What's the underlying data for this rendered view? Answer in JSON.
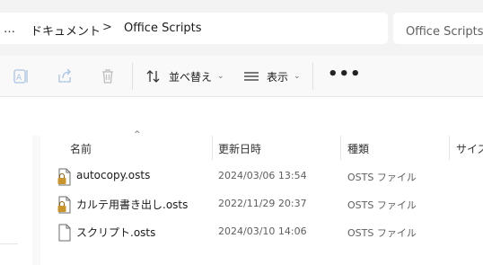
{
  "address_bar": {
    "more": "…",
    "breadcrumbs": [
      "ドキュメント",
      "Office Scripts"
    ],
    "separator": ">",
    "search_text": "Office Scriptsの"
  },
  "toolbar": {
    "sort_label": "並べ替え",
    "view_label": "表示",
    "more": "•••"
  },
  "columns": {
    "name": "名前",
    "modified": "更新日時",
    "type": "種類",
    "size": "サイズ"
  },
  "files": [
    {
      "name": "autocopy.osts",
      "modified": "2024/03/06 13:54",
      "type": "OSTS ファイル",
      "icon": "locked-file-icon"
    },
    {
      "name": "カルテ用書き出し.osts",
      "modified": "2022/11/29 20:37",
      "type": "OSTS ファイル",
      "icon": "locked-file-icon"
    },
    {
      "name": "スクリプト.osts",
      "modified": "2024/03/10 14:06",
      "type": "OSTS ファイル",
      "icon": "file-icon"
    }
  ]
}
